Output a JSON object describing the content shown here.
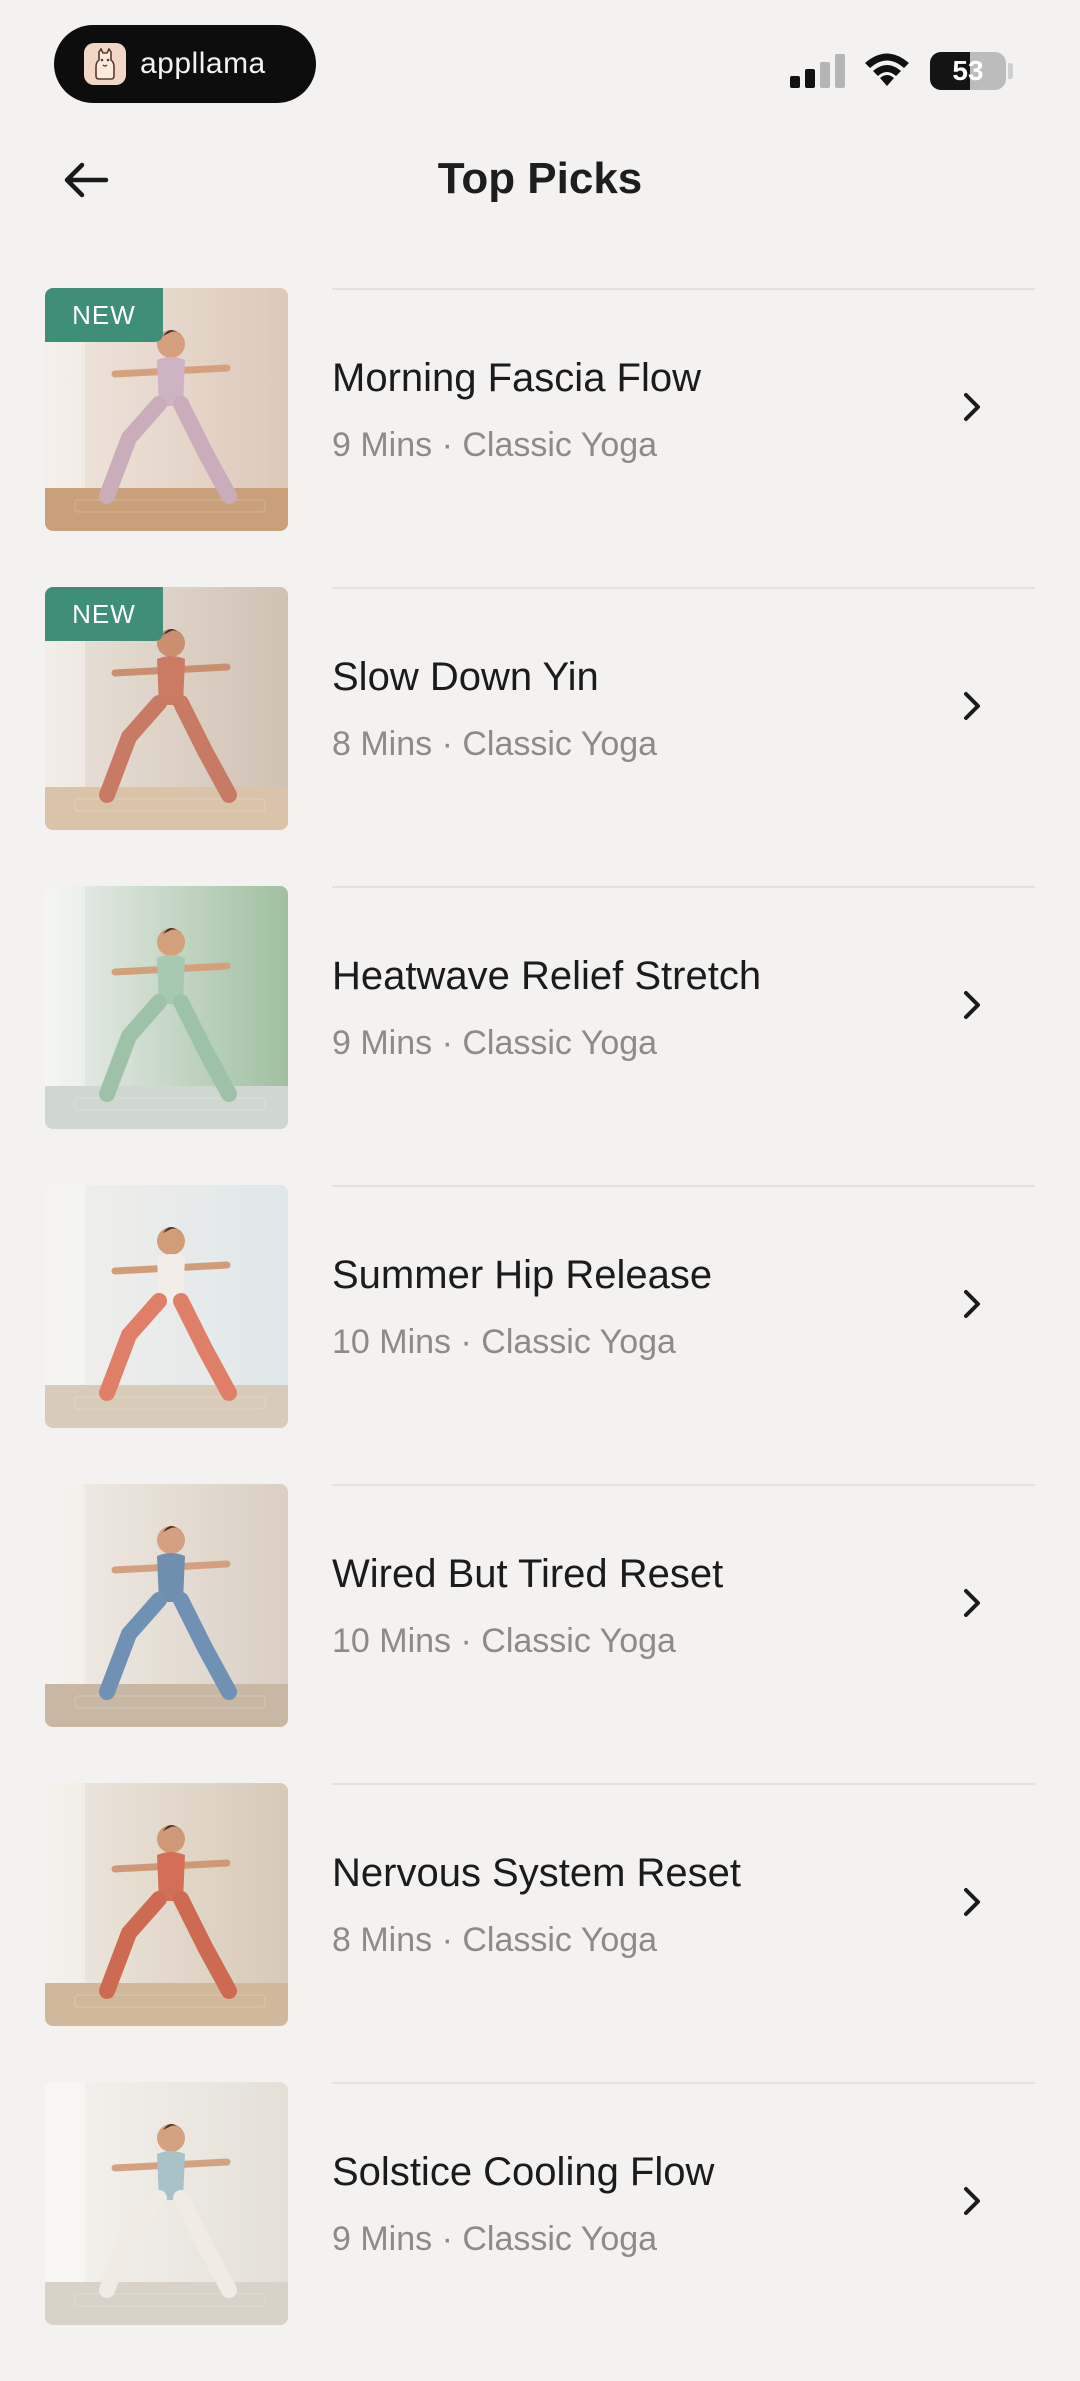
{
  "status_bar": {
    "app_name": "appllama",
    "battery_level": "53",
    "battery_percent": 53,
    "signal_bars_active": 2,
    "signal_bars_total": 4
  },
  "header": {
    "title": "Top Picks",
    "back_icon": "arrow-left-icon"
  },
  "colors": {
    "background": "#f3f2f0",
    "badge": "#3f8e78",
    "meta_text": "#8d8b88"
  },
  "items": [
    {
      "title": "Morning Fascia Flow",
      "meta": "9 Mins · Classic Yoga",
      "badge": "NEW",
      "palette": {
        "bg1": "#efe7df",
        "bg2": "#dcc9b8",
        "floor": "#c9a07a",
        "top": "#cdb3c4",
        "legs": "#c9adbb",
        "skin": "#d6a07f"
      }
    },
    {
      "title": "Slow Down Yin",
      "meta": "8 Mins · Classic Yoga",
      "badge": "NEW",
      "palette": {
        "bg1": "#eae3da",
        "bg2": "#cfc2b4",
        "floor": "#d9c4aa",
        "top": "#cc7b63",
        "legs": "#c97a64",
        "skin": "#c98f6e"
      }
    },
    {
      "title": "Heatwave Relief Stretch",
      "meta": "9 Mins · Classic Yoga",
      "badge": "",
      "palette": {
        "bg1": "#eef0ee",
        "bg2": "#9fc0a0",
        "floor": "#cfd8d0",
        "top": "#a8c9b1",
        "legs": "#9ec2a7",
        "skin": "#d3a07b"
      }
    },
    {
      "title": "Summer Hip Release",
      "meta": "10 Mins · Classic Yoga",
      "badge": "",
      "palette": {
        "bg1": "#f2efeb",
        "bg2": "#dfe7ea",
        "floor": "#d9cbb9",
        "top": "#f3ede8",
        "legs": "#e07f68",
        "skin": "#d39c78"
      }
    },
    {
      "title": "Wired But Tired Reset",
      "meta": "10 Mins · Classic Yoga",
      "badge": "",
      "palette": {
        "bg1": "#f1ede7",
        "bg2": "#d9cfc2",
        "floor": "#c8b8a3",
        "top": "#6f8fae",
        "legs": "#6f91b3",
        "skin": "#d5a07f"
      }
    },
    {
      "title": "Nervous System Reset",
      "meta": "8 Mins · Classic Yoga",
      "badge": "",
      "palette": {
        "bg1": "#efe9e1",
        "bg2": "#d6c9b7",
        "floor": "#d2b89a",
        "top": "#d26f55",
        "legs": "#cf6a52",
        "skin": "#cf9877"
      }
    },
    {
      "title": "Solstice Cooling Flow",
      "meta": "9 Mins · Classic Yoga",
      "badge": "",
      "palette": {
        "bg1": "#f5f3ef",
        "bg2": "#e4e0d8",
        "floor": "#d8d2c8",
        "top": "#a9c1c8",
        "legs": "#f0ece4",
        "skin": "#d4a27f"
      }
    }
  ]
}
